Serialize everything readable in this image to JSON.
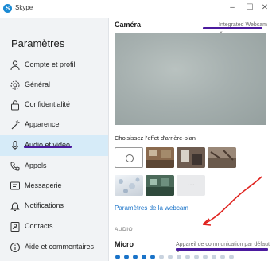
{
  "window": {
    "title": "Skype",
    "logo_glyph": "S",
    "minimize_glyph": "–",
    "maximize_glyph": "☐",
    "close_glyph": "✕"
  },
  "sidebar": {
    "title": "Paramètres",
    "items": [
      {
        "label": "Compte et profil",
        "icon": "person-icon"
      },
      {
        "label": "Général",
        "icon": "gear-icon"
      },
      {
        "label": "Confidentialité",
        "icon": "lock-icon"
      },
      {
        "label": "Apparence",
        "icon": "magic-wand-icon"
      },
      {
        "label": "Audio et vidéo",
        "icon": "microphone-icon",
        "selected": true
      },
      {
        "label": "Appels",
        "icon": "phone-icon"
      },
      {
        "label": "Messagerie",
        "icon": "message-icon"
      },
      {
        "label": "Notifications",
        "icon": "bell-icon"
      },
      {
        "label": "Contacts",
        "icon": "contacts-icon"
      },
      {
        "label": "Aide et commentaires",
        "icon": "info-icon"
      }
    ]
  },
  "camera": {
    "section_title": "Caméra",
    "device": "Integrated Webcam",
    "chevron": "⌄"
  },
  "background": {
    "caption": "Choisissez l'effet d'arrière-plan",
    "more_glyph": "···",
    "webcam_settings_link": "Paramètres de la webcam"
  },
  "audio": {
    "section_label": "AUDIO",
    "microphone_label": "Micro",
    "microphone_device": "Appareil de communication par défaut",
    "chevron": "⌄",
    "mic_level": 5,
    "mic_level_max": 14
  },
  "colors": {
    "accent": "#1a73c8",
    "selected_bg": "#d6ebf8",
    "annotation_purple": "#4b1a9e",
    "annotation_red": "#e0231f",
    "mic_active": "#1a73c8",
    "mic_inactive": "#c9d3df"
  }
}
